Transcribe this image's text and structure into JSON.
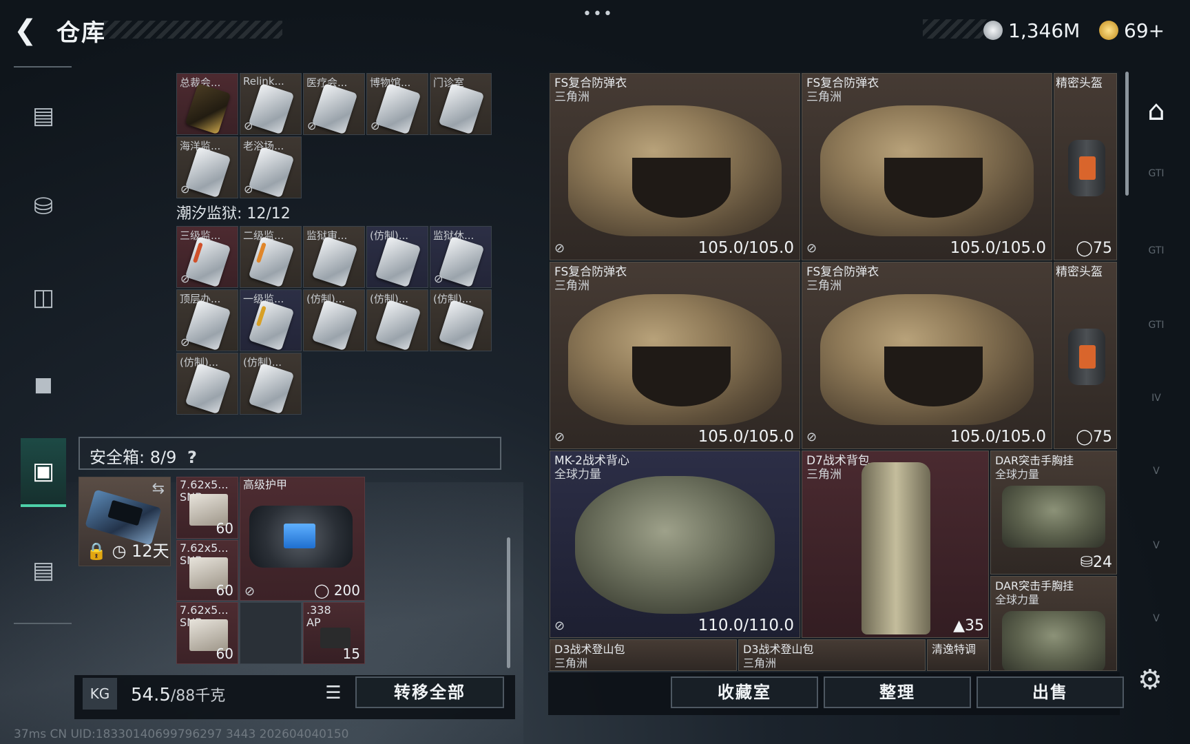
{
  "header": {
    "title": "仓库",
    "currency_silver": "1,346M",
    "currency_gold": "69+"
  },
  "left_nav": {
    "items": [
      "weapons",
      "armor",
      "chest-rig",
      "backpack",
      "safe-box",
      "briefcase"
    ],
    "active": "safe-box"
  },
  "key_grid_top": [
    {
      "label": "总裁会...",
      "color": "red",
      "key": "gold"
    },
    {
      "label": "Relink...",
      "color": "brown"
    },
    {
      "label": "医疗会...",
      "color": "brown"
    },
    {
      "label": "博物馆...",
      "color": "brown"
    },
    {
      "label": "门诊室",
      "color": "brown"
    },
    {
      "label": "海洋监...",
      "color": "brown"
    },
    {
      "label": "老浴场...",
      "color": "brown"
    }
  ],
  "prison": {
    "header": "潮汐监狱: 12/12",
    "keys": [
      {
        "label": "三级监...",
        "color": "red"
      },
      {
        "label": "二级监...",
        "color": "brown"
      },
      {
        "label": "监狱审...",
        "color": "brown"
      },
      {
        "label": "(仿制)...",
        "color": "blue"
      },
      {
        "label": "监狱休...",
        "color": "blue"
      },
      {
        "label": "顶层办...",
        "color": "brown"
      },
      {
        "label": "一级监...",
        "color": "blue"
      },
      {
        "label": "(仿制)...",
        "color": "brown"
      },
      {
        "label": "(仿制)...",
        "color": "brown"
      },
      {
        "label": "(仿制)...",
        "color": "brown"
      },
      {
        "label": "(仿制)...",
        "color": "brown"
      },
      {
        "label": "(仿制)...",
        "color": "brown"
      }
    ]
  },
  "safebox": {
    "label": "安全箱: 8/9",
    "help": "?",
    "days": "12天",
    "ammo": [
      {
        "label": "7.62x5...",
        "sub": "SNB",
        "count": "60"
      },
      {
        "label": "7.62x5...",
        "sub": "SNB",
        "count": "60"
      },
      {
        "label": "7.62x5...",
        "sub": "SNB",
        "count": "60"
      }
    ],
    "armor_bag": {
      "label": "高级护甲",
      "value": "200"
    },
    "ap338": {
      "label": ".338",
      "sub": "AP",
      "count": "15"
    }
  },
  "weight": {
    "current": "54.5",
    "max": "/88千克",
    "kg": "KG"
  },
  "buttons": {
    "transfer_all": "转移全部",
    "collection": "收藏室",
    "sort": "整理",
    "sell": "出售"
  },
  "status": "37ms  CN UID:18330140699796297 3443 202604040150",
  "inventory": [
    {
      "name": "FS复合防弹衣",
      "sub": "三角洲",
      "durability": "105.0/105.0"
    },
    {
      "name": "FS复合防弹衣",
      "sub": "三角洲",
      "durability": "105.0/105.0"
    },
    {
      "name": "精密头盔",
      "stat": "75"
    },
    {
      "name": "FS复合防弹衣",
      "sub": "三角洲",
      "durability": "105.0/105.0"
    },
    {
      "name": "FS复合防弹衣",
      "sub": "三角洲",
      "durability": "105.0/105.0"
    },
    {
      "name": "精密头盔",
      "stat": "75"
    },
    {
      "name": "MK-2战术背心",
      "sub": "全球力量",
      "durability": "110.0/110.0"
    },
    {
      "name": "D7战术背包",
      "sub": "三角洲",
      "stat": "35"
    },
    {
      "name": "DAR突击手胸挂",
      "sub": "全球力量",
      "stat": "24"
    },
    {
      "name": "DAR突击手胸挂",
      "sub": "全球力量"
    },
    {
      "name": "D3战术登山包",
      "sub": "三角洲"
    },
    {
      "name": "D3战术登山包",
      "sub": "三角洲"
    },
    {
      "name": "清逸特调"
    }
  ],
  "right_nav": [
    "home-icon",
    "GTI",
    "GTI",
    "GTI",
    "IV",
    "V",
    "V",
    "V"
  ]
}
